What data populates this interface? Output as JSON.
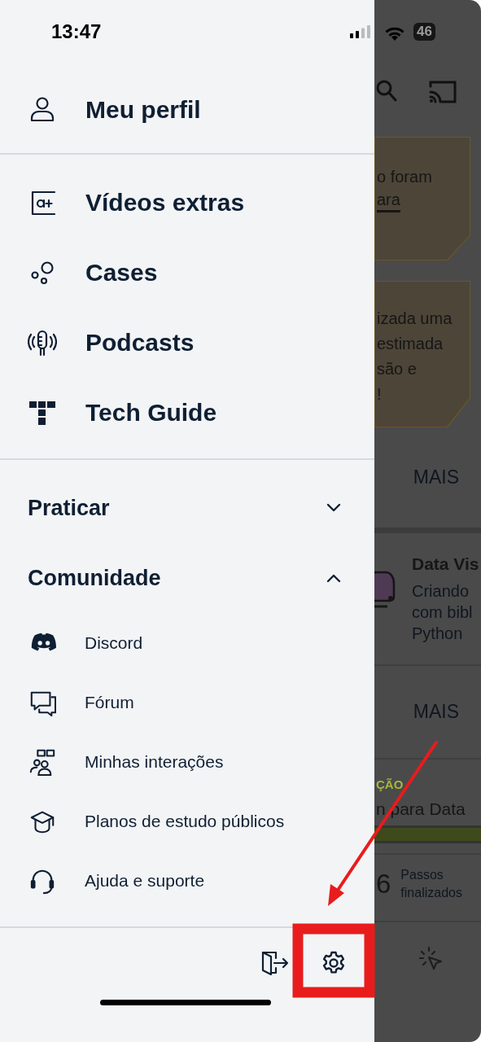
{
  "status_bar": {
    "time": "13:47",
    "battery": "46"
  },
  "drawer": {
    "profile": {
      "label": "Meu perfil"
    },
    "links": [
      {
        "label": "Vídeos extras"
      },
      {
        "label": "Cases"
      },
      {
        "label": "Podcasts"
      },
      {
        "label": "Tech Guide"
      }
    ],
    "sections": [
      {
        "label": "Praticar",
        "expanded": false
      },
      {
        "label": "Comunidade",
        "expanded": true,
        "children": [
          {
            "label": "Discord"
          },
          {
            "label": "Fórum"
          },
          {
            "label": "Minhas interações"
          },
          {
            "label": "Planos de estudo públicos"
          },
          {
            "label": "Ajuda e suporte"
          }
        ]
      }
    ]
  },
  "background": {
    "notices": [
      {
        "lines": [
          "o foram"
        ],
        "link": "ara"
      },
      {
        "lines": [
          "izada uma",
          "estimada",
          "são e",
          "!"
        ]
      }
    ],
    "more_1": {
      "label": "MAIS"
    },
    "course": {
      "title": "Data Vis",
      "lines": [
        "Criando",
        "com bibl",
        "Python"
      ]
    },
    "more_2": {
      "label": "MAIS"
    },
    "track": {
      "tag": "ÇÃO",
      "title": "n para Data",
      "progress": {
        "level": 1
      },
      "count": "6",
      "count_label": "Passos finalizados"
    }
  }
}
